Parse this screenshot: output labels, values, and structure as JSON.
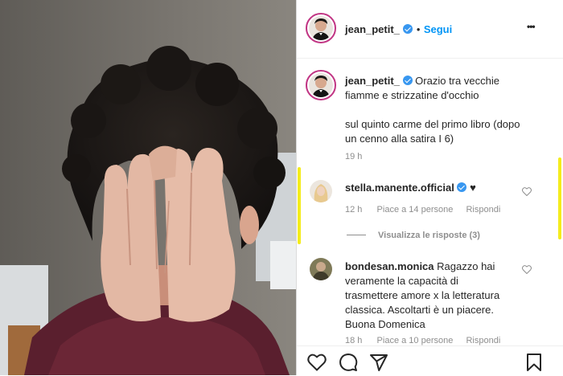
{
  "header": {
    "username": "jean_petit_",
    "dot": "•",
    "follow_label": "Segui",
    "more_label": "•••"
  },
  "caption": {
    "username": "jean_petit_",
    "text_line1": "Orazio tra vecchie",
    "text_line2": "fiamme e strizzatine d'occhio",
    "body_line1": "sul quinto carme del primo libro (dopo",
    "body_line2": "un cenno alla satira I 6)",
    "time": "19 h"
  },
  "comments": [
    {
      "username": "stella.manente.official",
      "text": "♥",
      "time": "12 h",
      "likes": "Piace a 14 persone",
      "reply": "Rispondi",
      "view_replies": "Visualizza le risposte (3)"
    },
    {
      "username": "bondesan.monica",
      "text_line1": "Ragazzo hai",
      "text_line2": "veramente la capacità di",
      "text_line3": "trasmettere amore x la letteratura",
      "text_line4": "classica. Ascoltarti è un piacere.",
      "text_line5": "Buona Domenica",
      "time": "18 h",
      "likes": "Piace a 10 persone",
      "reply": "Rispondi"
    }
  ],
  "actions": {
    "like_icon": "heart-icon",
    "comment_icon": "comment-icon",
    "share_icon": "send-icon",
    "save_icon": "bookmark-icon"
  },
  "colors": {
    "accent": "#0095f6",
    "verified": "#3897f0",
    "highlight": "#f4ec1c"
  }
}
